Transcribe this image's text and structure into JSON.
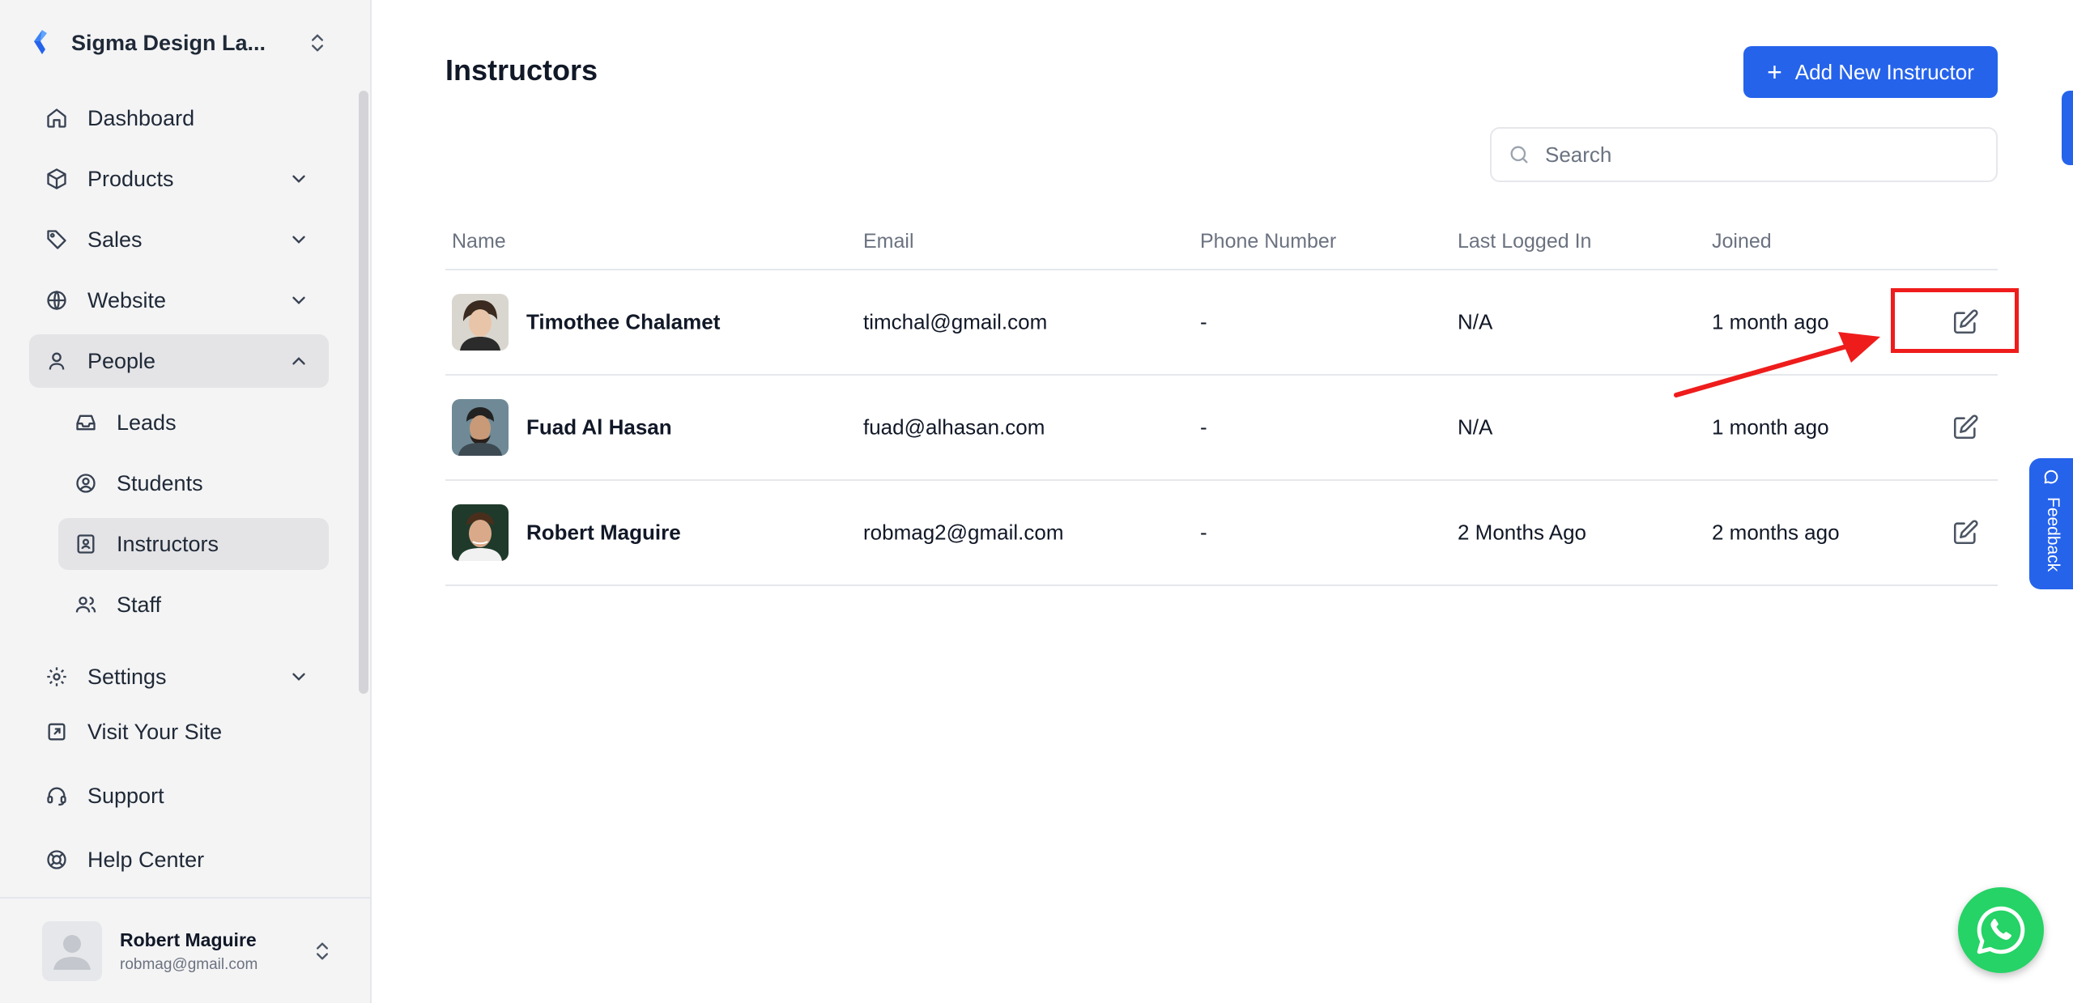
{
  "sidebar": {
    "org_name": "Sigma Design La...",
    "nav": {
      "dashboard": "Dashboard",
      "products": "Products",
      "sales": "Sales",
      "website": "Website",
      "people": "People",
      "leads": "Leads",
      "students": "Students",
      "instructors": "Instructors",
      "staff": "Staff",
      "settings": "Settings",
      "visit_site": "Visit Your Site",
      "support": "Support",
      "help_center": "Help Center"
    },
    "user": {
      "name": "Robert Maguire",
      "email": "robmag@gmail.com"
    }
  },
  "main": {
    "title": "Instructors",
    "add_button": "Add New Instructor",
    "search_placeholder": "Search",
    "columns": [
      "Name",
      "Email",
      "Phone Number",
      "Last Logged In",
      "Joined"
    ],
    "rows": [
      {
        "name": "Timothee Chalamet",
        "email": "timchal@gmail.com",
        "phone": "-",
        "last_logged_in": "N/A",
        "joined": "1 month ago"
      },
      {
        "name": "Fuad Al Hasan",
        "email": "fuad@alhasan.com",
        "phone": "-",
        "last_logged_in": "N/A",
        "joined": "1 month ago"
      },
      {
        "name": "Robert Maguire",
        "email": "robmag2@gmail.com",
        "phone": "-",
        "last_logged_in": "2 Months Ago",
        "joined": "2 months ago"
      }
    ]
  },
  "feedback_label": "Feedback",
  "colors": {
    "primary": "#2563eb",
    "annotation": "#ef1c1c",
    "whatsapp": "#25d366"
  }
}
